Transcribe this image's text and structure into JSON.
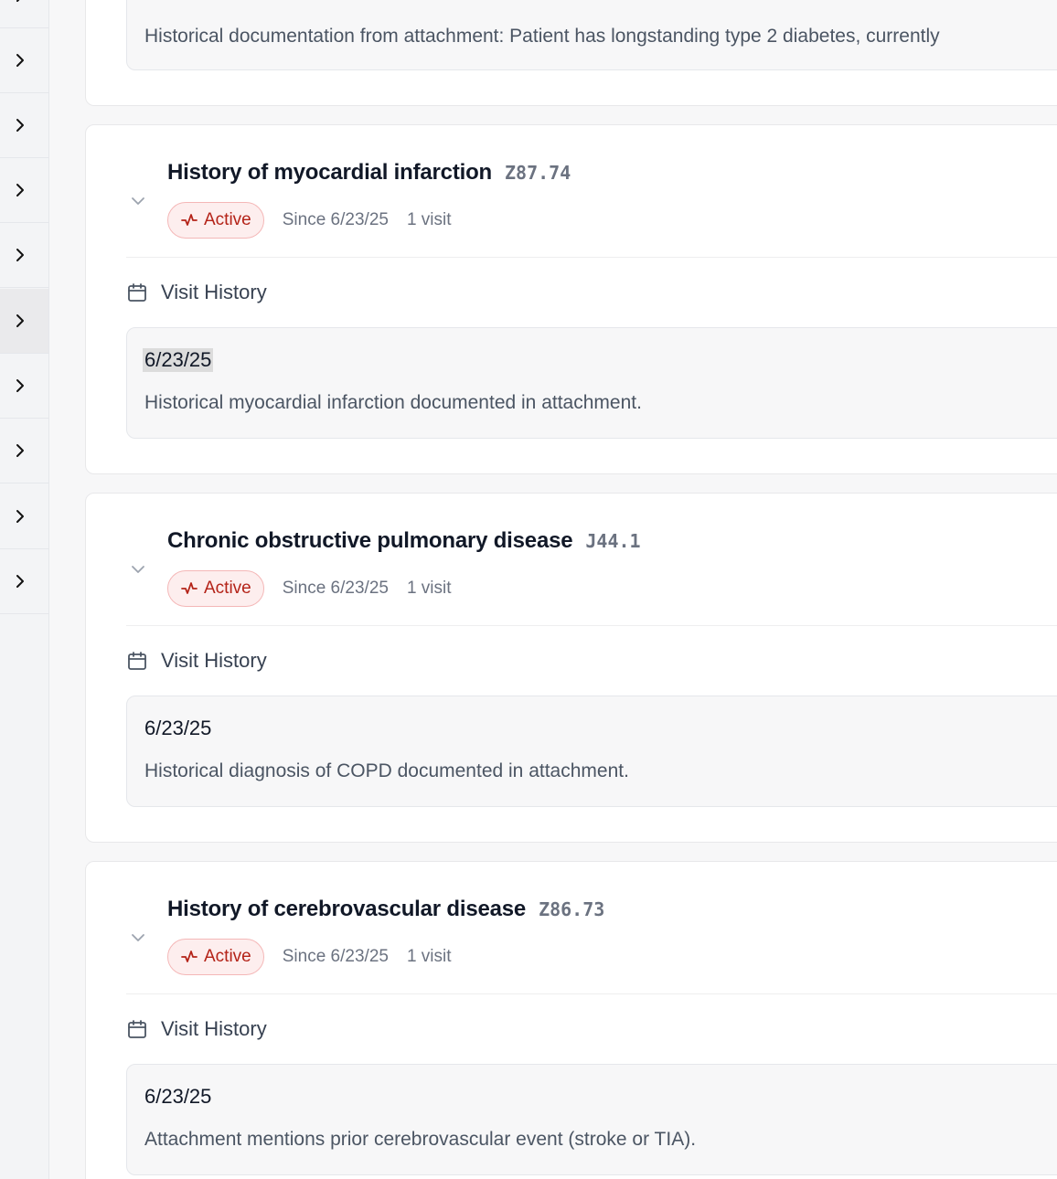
{
  "rail": {
    "item_count": 9,
    "active_index": 4
  },
  "top_card": {
    "visit_note": "Historical documentation from attachment: Patient has longstanding type 2 diabetes, currently"
  },
  "conditions": [
    {
      "title": "History of myocardial infarction",
      "code": "Z87.74",
      "status": "Active",
      "since": "Since 6/23/25",
      "visits": "1 visit",
      "visit_history_label": "Visit History",
      "visit_date": "6/23/25",
      "visit_note": "Historical myocardial infarction documented in attachment."
    },
    {
      "title": "Chronic obstructive pulmonary disease",
      "code": "J44.1",
      "status": "Active",
      "since": "Since 6/23/25",
      "visits": "1 visit",
      "visit_history_label": "Visit History",
      "visit_date": "6/23/25",
      "visit_note": "Historical diagnosis of COPD documented in attachment."
    },
    {
      "title": "History of cerebrovascular disease",
      "code": "Z86.73",
      "status": "Active",
      "since": "Since 6/23/25",
      "visits": "1 visit",
      "visit_history_label": "Visit History",
      "visit_date": "6/23/25",
      "visit_note": "Attachment mentions prior cerebrovascular event (stroke or TIA)."
    }
  ],
  "colors": {
    "active_badge_bg": "#fdeeee",
    "active_badge_text": "#b42318"
  }
}
